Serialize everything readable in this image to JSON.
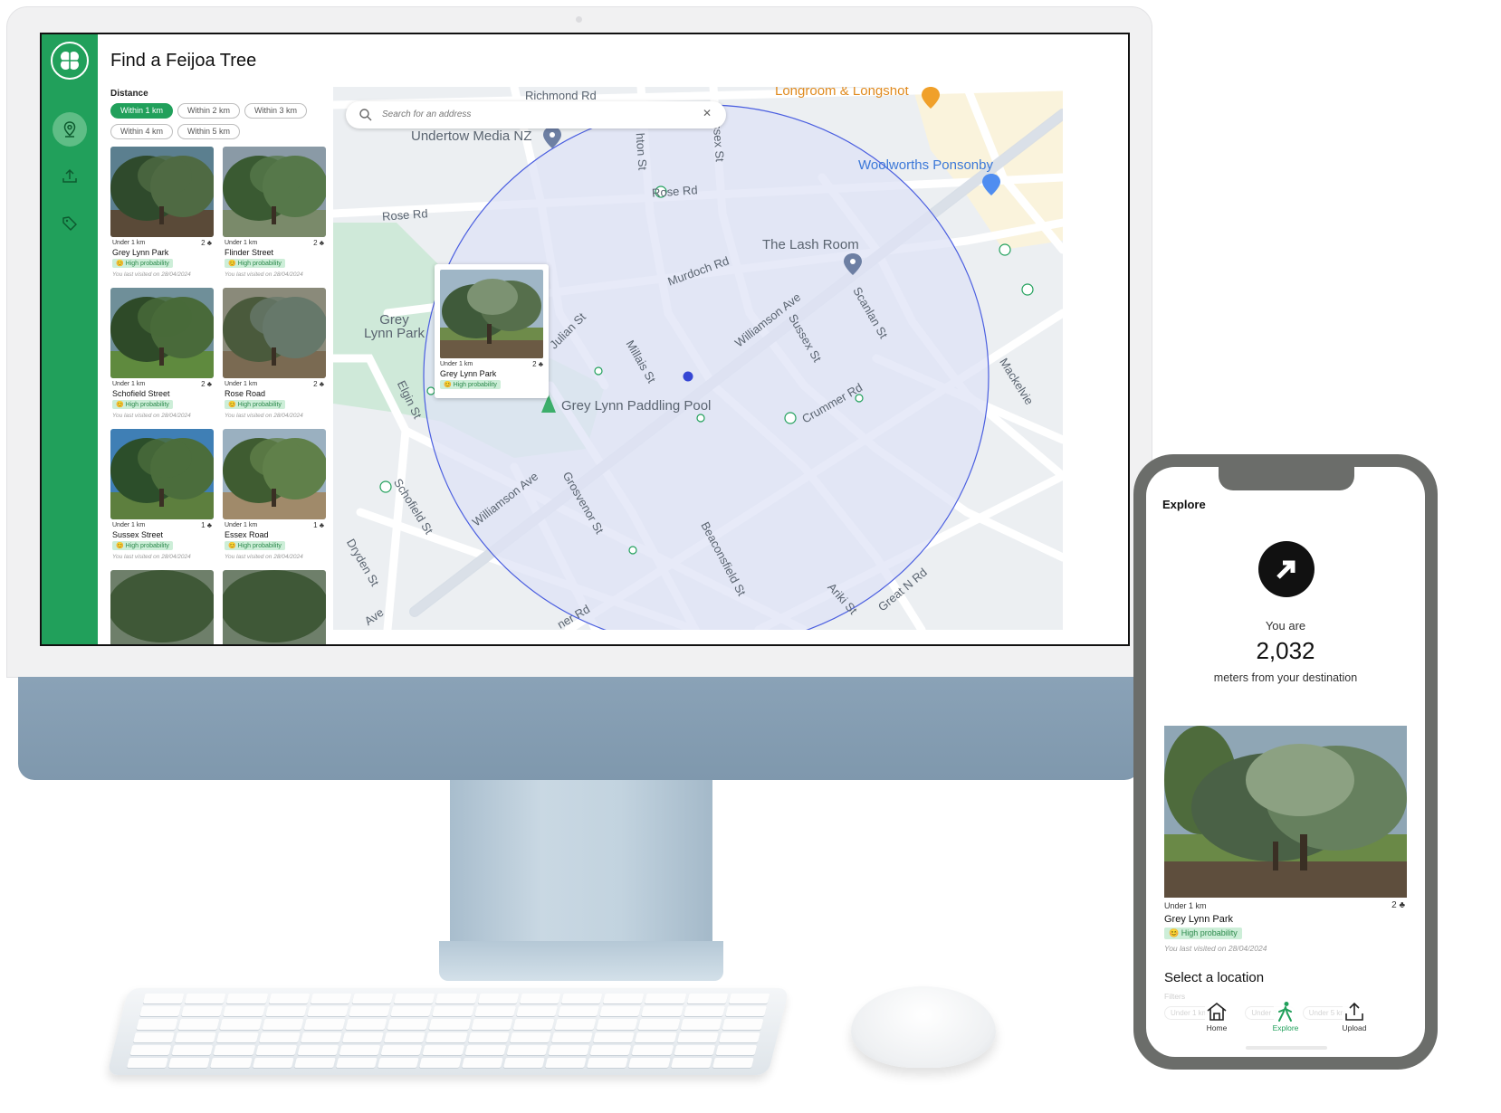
{
  "desktop": {
    "title": "Find a Feijoa Tree",
    "filter_label": "Distance",
    "chips": [
      "Within 1 km",
      "Within 2 km",
      "Within 3 km",
      "Within 4 km",
      "Within 5 km"
    ],
    "selected_chip": "Within 1 km",
    "sidebar": {
      "items": [
        {
          "icon": "map-pin-icon",
          "active": true
        },
        {
          "icon": "upload-icon",
          "active": false
        },
        {
          "icon": "tag-icon",
          "active": false
        }
      ]
    },
    "cards": [
      {
        "distance": "Under 1 km",
        "count": "2",
        "name": "Grey Lynn Park",
        "probability": "High probability",
        "visited": "You last visited on 28/04/2024"
      },
      {
        "distance": "Under 1 km",
        "count": "2",
        "name": "Flinder Street",
        "probability": "High probability",
        "visited": "You last visited on 28/04/2024"
      },
      {
        "distance": "Under 1 km",
        "count": "2",
        "name": "Schofield Street",
        "probability": "High probability",
        "visited": "You last visited on 28/04/2024"
      },
      {
        "distance": "Under 1 km",
        "count": "2",
        "name": "Rose Road",
        "probability": "High probability",
        "visited": "You last visited on 28/04/2024"
      },
      {
        "distance": "Under 1 km",
        "count": "1",
        "name": "Sussex Street",
        "probability": "High probability",
        "visited": "You last visited on 28/04/2024"
      },
      {
        "distance": "Under 1 km",
        "count": "1",
        "name": "Essex Road",
        "probability": "High probability",
        "visited": "You last visited on 28/04/2024"
      }
    ],
    "map": {
      "search_placeholder": "Search for an address",
      "labels": {
        "richmond": "Richmond Rd",
        "longroom": "Longroom & Longshot",
        "undertow": "Undertow Media NZ",
        "ponsonby": "Woolworths Ponsonby",
        "rose1": "Rose Rd",
        "rose2": "Rose Rd",
        "lash": "The Lash Room",
        "murdoch": "Murdoch Rd",
        "williamson1": "Williamson Ave",
        "williamson2": "Williamson Ave",
        "grey_lynn_park": "Grey\nLynn Park",
        "julian": "Julian St",
        "millais": "Millais St",
        "sussex1": "Sussex St",
        "sussex2": "Sussex St",
        "scanlan": "Scanlan St",
        "paddling": "Grey Lynn Paddling Pool",
        "crummer": "Crummer Rd",
        "elgin": "Elgin St",
        "schofield": "Schofield St",
        "grosvenor": "Grosvenor St",
        "beaconsfield": "Beaconsfield St",
        "dryden": "Dryden St",
        "ariki": "Ariki St",
        "great_n": "Great N Rd",
        "mackelvie": "Mackelvie",
        "hton": "hton St",
        "ave": "Ave",
        "ner": "ner Rd"
      },
      "popup": {
        "distance": "Under 1 km",
        "count": "2",
        "name": "Grey Lynn Park",
        "probability": "High probability"
      },
      "colors": {
        "radius_fill": "#dfe3f6",
        "radius_stroke": "#4a5ee0",
        "park": "#cfe9d9"
      }
    }
  },
  "phone": {
    "title": "Explore",
    "you_are": "You are",
    "meters": "2,032",
    "destination": "meters from your destination",
    "card": {
      "distance": "Under 1 km",
      "count": "2",
      "name": "Grey Lynn Park",
      "probability": "High probability",
      "visited": "You last visited on 28/04/2024"
    },
    "select_location": "Select a location",
    "filters_label": "Filters",
    "filter_chips": [
      "Under 1 km",
      "Under 3 km",
      "Under 5 km"
    ],
    "nav": [
      {
        "label": "Home",
        "icon": "home-icon",
        "active": false
      },
      {
        "label": "Explore",
        "icon": "walking-person-icon",
        "active": true
      },
      {
        "label": "Upload",
        "icon": "upload-icon",
        "active": false
      }
    ]
  },
  "colors": {
    "brand": "#21a05b",
    "chip_bg": "#cdeed8",
    "chip_text": "#2c8a4c",
    "imac_blue": "#8aa2b7"
  }
}
